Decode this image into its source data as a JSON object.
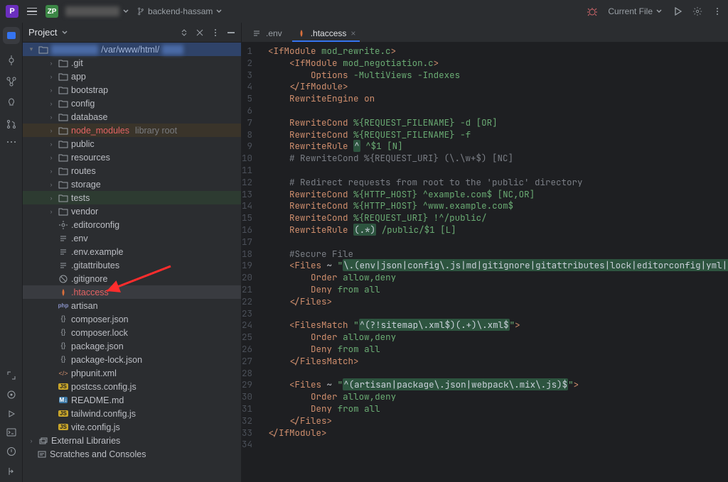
{
  "titlebar": {
    "branch": "backend-hassam",
    "run_config": "Current File"
  },
  "sidebar": {
    "title": "Project",
    "root_path": "/var/www/html/",
    "items": [
      {
        "name": ".git",
        "type": "folder",
        "depth": 2
      },
      {
        "name": "app",
        "type": "folder",
        "depth": 2
      },
      {
        "name": "bootstrap",
        "type": "folder",
        "depth": 2
      },
      {
        "name": "config",
        "type": "folder",
        "depth": 2
      },
      {
        "name": "database",
        "type": "folder",
        "depth": 2
      },
      {
        "name": "node_modules",
        "type": "folder",
        "depth": 2,
        "nm": true,
        "suffix": "library root"
      },
      {
        "name": "public",
        "type": "folder",
        "depth": 2
      },
      {
        "name": "resources",
        "type": "folder",
        "depth": 2
      },
      {
        "name": "routes",
        "type": "folder",
        "depth": 2
      },
      {
        "name": "storage",
        "type": "folder",
        "depth": 2
      },
      {
        "name": "tests",
        "type": "folder",
        "depth": 2,
        "tests": true
      },
      {
        "name": "vendor",
        "type": "folder",
        "depth": 2
      },
      {
        "name": ".editorconfig",
        "type": "file",
        "depth": 2,
        "ico": "gear"
      },
      {
        "name": ".env",
        "type": "file",
        "depth": 2,
        "ico": "lines"
      },
      {
        "name": ".env.example",
        "type": "file",
        "depth": 2,
        "ico": "lines"
      },
      {
        "name": ".gitattributes",
        "type": "file",
        "depth": 2,
        "ico": "lines"
      },
      {
        "name": ".gitignore",
        "type": "file",
        "depth": 2,
        "ico": "ban"
      },
      {
        "name": ".htaccess",
        "type": "file",
        "depth": 2,
        "ico": "apache",
        "red": true,
        "sel": true
      },
      {
        "name": "artisan",
        "type": "file",
        "depth": 2,
        "ico": "php"
      },
      {
        "name": "composer.json",
        "type": "file",
        "depth": 2,
        "ico": "json"
      },
      {
        "name": "composer.lock",
        "type": "file",
        "depth": 2,
        "ico": "json"
      },
      {
        "name": "package.json",
        "type": "file",
        "depth": 2,
        "ico": "json"
      },
      {
        "name": "package-lock.json",
        "type": "file",
        "depth": 2,
        "ico": "json"
      },
      {
        "name": "phpunit.xml",
        "type": "file",
        "depth": 2,
        "ico": "xml"
      },
      {
        "name": "postcss.config.js",
        "type": "file",
        "depth": 2,
        "ico": "js"
      },
      {
        "name": "README.md",
        "type": "file",
        "depth": 2,
        "ico": "md"
      },
      {
        "name": "tailwind.config.js",
        "type": "file",
        "depth": 2,
        "ico": "js"
      },
      {
        "name": "vite.config.js",
        "type": "file",
        "depth": 2,
        "ico": "js"
      }
    ],
    "external": "External Libraries",
    "scratches": "Scratches and Consoles"
  },
  "tabs": [
    {
      "label": ".env",
      "ico": "lines"
    },
    {
      "label": ".htaccess",
      "ico": "apache",
      "active": true
    }
  ],
  "code": {
    "lines": [
      {
        "n": 1,
        "html": "<span class='tk-tag'>&lt;IfModule</span> <span class='tk-arg'>mod_rewrite.c</span><span class='tk-tag'>&gt;</span>"
      },
      {
        "n": 2,
        "html": "    <span class='tk-tag'>&lt;IfModule</span> <span class='tk-arg'>mod_negotiation.c</span><span class='tk-tag'>&gt;</span>"
      },
      {
        "n": 3,
        "html": "        <span class='tk-dir'>Options</span> <span class='tk-arg'>-MultiViews -Indexes</span>"
      },
      {
        "n": 4,
        "html": "    <span class='tk-tag'>&lt;/IfModule&gt;</span>"
      },
      {
        "n": 5,
        "html": "    <span class='tk-dir'>RewriteEngine</span> <span class='tk-on'>on</span>"
      },
      {
        "n": 6,
        "html": ""
      },
      {
        "n": 7,
        "html": "    <span class='tk-dir'>RewriteCond</span> <span class='tk-arg'>%{REQUEST_FILENAME} -d [OR]</span>"
      },
      {
        "n": 8,
        "html": "    <span class='tk-dir'>RewriteCond</span> <span class='tk-arg'>%{REQUEST_FILENAME} -f</span>"
      },
      {
        "n": 9,
        "html": "    <span class='tk-dir'>RewriteRule</span> <span class='tk-regex'>^</span> <span class='tk-arg'>^$1 [N]</span>"
      },
      {
        "n": 10,
        "html": "    <span class='tk-comment'># RewriteCond %{REQUEST_URI} (\\.\\w+$) [NC]</span>"
      },
      {
        "n": 11,
        "html": ""
      },
      {
        "n": 12,
        "html": "    <span class='tk-comment'># Redirect requests from root to the 'public' directory</span>"
      },
      {
        "n": 13,
        "html": "    <span class='tk-dir'>RewriteCond</span> <span class='tk-arg'>%{HTTP_HOST} ^example.com$ [NC,OR]</span>"
      },
      {
        "n": 14,
        "html": "    <span class='tk-dir'>RewriteCond</span> <span class='tk-arg'>%{HTTP_HOST} ^www.example.com$</span>"
      },
      {
        "n": 15,
        "html": "    <span class='tk-dir'>RewriteCond</span> <span class='tk-arg'>%{REQUEST_URI} !^/public/</span>"
      },
      {
        "n": 16,
        "html": "    <span class='tk-dir'>RewriteRule</span> <span class='tk-regex'>(.*)</span> <span class='tk-arg'>/public/$1 [L]</span>"
      },
      {
        "n": 17,
        "html": ""
      },
      {
        "n": 18,
        "html": "    <span class='tk-comment'>#Secure File</span>"
      },
      {
        "n": 19,
        "html": "    <span class='tk-tag'>&lt;Files</span> ~ <span class='tk-str'>\"</span><span class='tk-regex'>\\.(env|json|config\\.js|md|gitignore|gitattributes|lock|editorconfig|yml|styleci\\</span>"
      },
      {
        "n": 20,
        "html": "        <span class='tk-dir'>Order</span> <span class='tk-arg'>allow,deny</span>"
      },
      {
        "n": 21,
        "html": "        <span class='tk-dir'>Deny</span> <span class='tk-arg'>from all</span>"
      },
      {
        "n": 22,
        "html": "    <span class='tk-tag'>&lt;/Files&gt;</span>"
      },
      {
        "n": 23,
        "html": ""
      },
      {
        "n": 24,
        "html": "    <span class='tk-tag'>&lt;FilesMatch</span> <span class='tk-str'>\"</span><span class='tk-regex'>^(?!sitemap\\.xml$)(.+)\\.xml$</span><span class='tk-str'>\"</span><span class='tk-tag'>&gt;</span>"
      },
      {
        "n": 25,
        "html": "        <span class='tk-dir'>Order</span> <span class='tk-arg'>allow,deny</span>"
      },
      {
        "n": 26,
        "html": "        <span class='tk-dir'>Deny</span> <span class='tk-arg'>from all</span>"
      },
      {
        "n": 27,
        "html": "    <span class='tk-tag'>&lt;/FilesMatch&gt;</span>"
      },
      {
        "n": 28,
        "html": ""
      },
      {
        "n": 29,
        "html": "    <span class='tk-tag'>&lt;Files</span> ~ <span class='tk-str'>\"</span><span class='tk-regex'>^(artisan|package\\.json|webpack\\.mix\\.js)$</span><span class='tk-str'>\"</span><span class='tk-tag'>&gt;</span>"
      },
      {
        "n": 30,
        "html": "        <span class='tk-dir'>Order</span> <span class='tk-arg'>allow,deny</span>"
      },
      {
        "n": 31,
        "html": "        <span class='tk-dir'>Deny</span> <span class='tk-arg'>from all</span>"
      },
      {
        "n": 32,
        "html": "    <span class='tk-tag'>&lt;/Files&gt;</span>"
      },
      {
        "n": 33,
        "html": "<span class='tk-tag'>&lt;/IfModule&gt;</span>"
      },
      {
        "n": 34,
        "html": ""
      }
    ]
  },
  "colors": {
    "accent": "#3574f0"
  }
}
